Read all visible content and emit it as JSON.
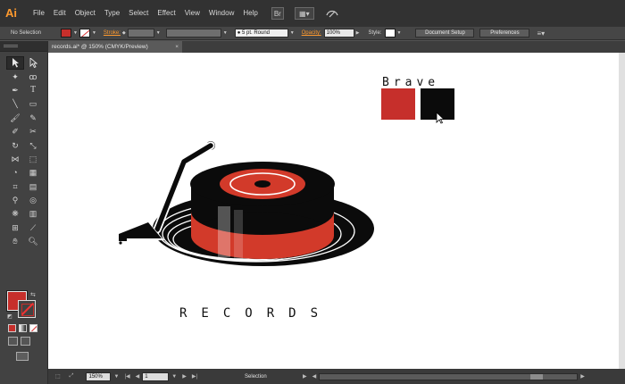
{
  "app": {
    "logo": "Ai"
  },
  "menu": [
    "File",
    "Edit",
    "Object",
    "Type",
    "Select",
    "Effect",
    "View",
    "Window",
    "Help"
  ],
  "menubar_icons": {
    "bridge": "Br",
    "arrange": "▦▾",
    "gpu": "sync-icon"
  },
  "control": {
    "selection": "No Selection",
    "stroke_label": "Stroke:",
    "stroke_weight": "",
    "brush": "5 pt. Round",
    "opacity_label": "Opacity:",
    "opacity": "100%",
    "style_label": "Style:",
    "document_setup": "Document Setup",
    "preferences": "Preferences",
    "fill_color": "#c62f2b"
  },
  "tab": {
    "title": "records.ai* @ 150% (CMYK/Preview)",
    "close": "×"
  },
  "artwork": {
    "swatch_title": "Brave",
    "swatches": [
      "#c62f2b",
      "#0b0b0b"
    ],
    "logo_text": "RECORDS",
    "colors": {
      "black": "#0b0b0b",
      "red": "#d23a2a",
      "white": "#ffffff"
    }
  },
  "status": {
    "zoom": "150%",
    "page": "1",
    "mode": "Selection"
  }
}
